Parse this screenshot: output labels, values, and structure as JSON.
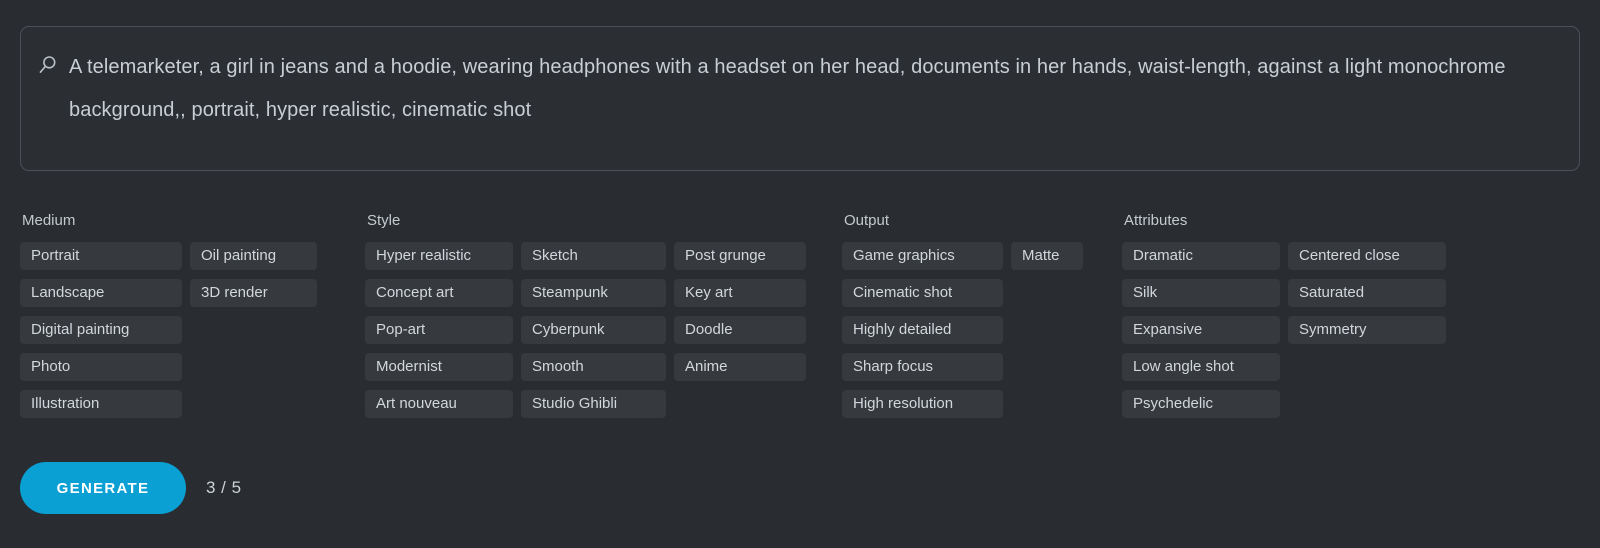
{
  "colors": {
    "page_background": "#292d31",
    "input_background": "#2b2f34",
    "input_border": "#4b5057",
    "tag_background": "#36393d",
    "tag_text": "#d2d7dc",
    "heading_text": "#c4c9ce",
    "accent_button": "#0aa0d3",
    "button_text": "#ffffff"
  },
  "prompt": {
    "icon": "search-icon",
    "value": "A telemarketer, a girl in jeans and a hoodie, wearing headphones with a headset on her head, documents in her hands, waist-length, against a light monochrome background,, portrait, hyper realistic, cinematic shot",
    "placeholder": "A telemarketer, a girl in jeans and a hoodie, wearing headphones with a headset on her head, documents in her hands, waist-length, against a light monochrome background,, portrait, hyper realistic, cinematic shot"
  },
  "groups": [
    {
      "title": "Medium",
      "columns": [
        [
          "Portrait",
          "Landscape",
          "Digital painting",
          "Photo",
          "Illustration"
        ],
        [
          "Oil painting",
          "3D render"
        ]
      ]
    },
    {
      "title": "Style",
      "columns": [
        [
          "Hyper realistic",
          "Concept art",
          "Pop-art",
          "Modernist",
          "Art nouveau"
        ],
        [
          "Sketch",
          "Steampunk",
          "Cyberpunk",
          "Smooth",
          "Studio Ghibli"
        ],
        [
          "Post grunge",
          "Key art",
          "Doodle",
          "Anime"
        ]
      ]
    },
    {
      "title": "Output",
      "columns": [
        [
          "Game graphics",
          "Cinematic shot",
          "Highly detailed",
          "Sharp focus",
          "High resolution"
        ],
        [
          "Matte"
        ]
      ]
    },
    {
      "title": "Attributes",
      "columns": [
        [
          "Dramatic",
          "Silk",
          "Expansive",
          "Low angle shot",
          "Psychedelic"
        ],
        [
          "Centered close",
          "Saturated",
          "Symmetry"
        ]
      ]
    }
  ],
  "footer": {
    "generate_label": "GENERATE",
    "counter": "3 / 5"
  }
}
